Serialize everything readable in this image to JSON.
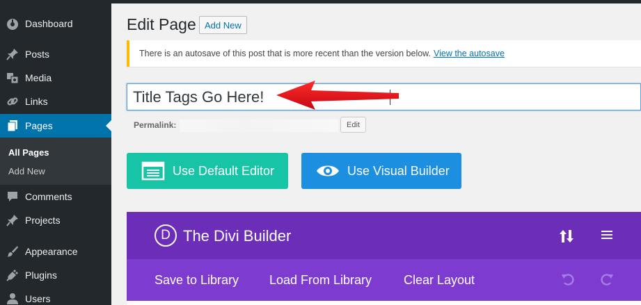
{
  "sidebar": {
    "items": [
      {
        "label": "Dashboard",
        "icon": "dashboard-icon"
      },
      {
        "label": "Posts",
        "icon": "pin-icon"
      },
      {
        "label": "Media",
        "icon": "media-icon"
      },
      {
        "label": "Links",
        "icon": "link-icon"
      },
      {
        "label": "Pages",
        "icon": "pages-icon"
      },
      {
        "label": "Comments",
        "icon": "comment-icon"
      },
      {
        "label": "Projects",
        "icon": "pin-icon"
      },
      {
        "label": "Appearance",
        "icon": "brush-icon"
      },
      {
        "label": "Plugins",
        "icon": "plug-icon"
      },
      {
        "label": "Users",
        "icon": "user-icon"
      }
    ],
    "current": "Pages",
    "submenu": [
      {
        "label": "All Pages"
      },
      {
        "label": "Add New"
      }
    ]
  },
  "header": {
    "title": "Edit Page",
    "add_new_label": "Add New"
  },
  "notice": {
    "text": "There is an autosave of this post that is more recent than the version below.",
    "link_label": "View the autosave"
  },
  "title_field": {
    "value": "Title Tags Go Here!"
  },
  "permalink": {
    "label": "Permalink:",
    "edit_label": "Edit"
  },
  "editor_buttons": {
    "default_label": "Use Default Editor",
    "visual_label": "Use Visual Builder"
  },
  "divi": {
    "logo_letter": "D",
    "title": "The Divi Builder",
    "toolbar": {
      "save_label": "Save to Library",
      "load_label": "Load From Library",
      "clear_label": "Clear Layout"
    }
  },
  "colors": {
    "sidebar_bg": "#23282d",
    "accent": "#0073aa",
    "notice_border": "#ffb900",
    "default_editor_btn": "#17c5a6",
    "visual_builder_btn": "#1d8fe0",
    "divi_header": "#6c2eb9",
    "divi_toolbar": "#7e3bd0",
    "annotation_arrow": "#e8101a"
  }
}
